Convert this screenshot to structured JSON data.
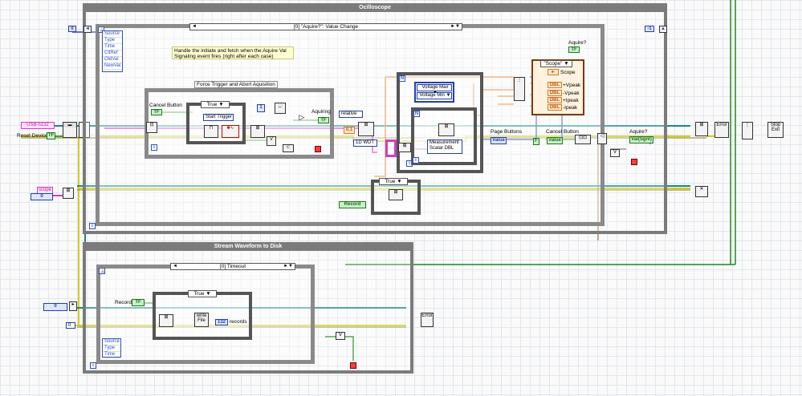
{
  "oscilloscope_loop": {
    "title": "Ocilloscope",
    "event_case": "[0] \"Aquire?\": Value Change",
    "event_data": [
      "Source",
      "Type",
      "Time",
      "CtlRef",
      "OldVal",
      "NewVal"
    ],
    "comment": "Handle the initiate and fetch when the Aquire Val Signaling event fires (right after each case)",
    "force_trigger_label": "Force Trigger and Abort Aquisition",
    "cancel_button_label": "Cancel Button",
    "case_true": "True",
    "start_trigger_label": "Start Trigger",
    "aquiring_label": "Aquiring",
    "relative_const": "relative",
    "range_const": "0,1",
    "wdt_label": "1D WDT",
    "voltage_max": "Voltage Max",
    "voltage_min": "Voltage Min",
    "measurement_label": "Measurement Scalar DBL",
    "scope_cluster": "\"Scope\"",
    "scope_label": "Scope",
    "peak_labels": [
      "+Vpeak",
      "-Vpeak",
      "+Ipeak",
      "-Ipeak"
    ],
    "page_buttons_label": "Page Buttons",
    "value_label": "Value",
    "cancel_button_label_2": "Cancel Button",
    "aquire_label": "Aquire?",
    "aquire_label_top": "Aquire?",
    "val_sgnl": "Val(Sgnl)",
    "record_label": "Record",
    "inner_case_true": "True",
    "tf": "TF",
    "idx_left": "0",
    "idx_right": "-1"
  },
  "left_side": {
    "device_const": "USB-5132",
    "reset_device": "Reset Device",
    "scope_str": "scope",
    "zero": "0"
  },
  "stream_loop": {
    "title": "Stream Waveform to Disk",
    "event_case": "[0] Timeout",
    "record_label": "Record",
    "case_true": "True",
    "records_label": "records",
    "event_data": [
      "Source",
      "Type",
      "Time"
    ],
    "write_file": "write File",
    "i32": "132",
    "zero": "0",
    "seq": "0"
  },
  "right_side": {
    "error_label": "Error",
    "stop_label": "Stop Exit"
  },
  "colors": {
    "error_wire": "#d8d818",
    "bool_wire": "#1e8a1e",
    "dbl_wire": "#e07a1e",
    "i32_wire": "#2040c0",
    "string_wire": "#d040c0",
    "ref_wire": "#16888a",
    "cluster_wire": "#9a5a1a"
  }
}
